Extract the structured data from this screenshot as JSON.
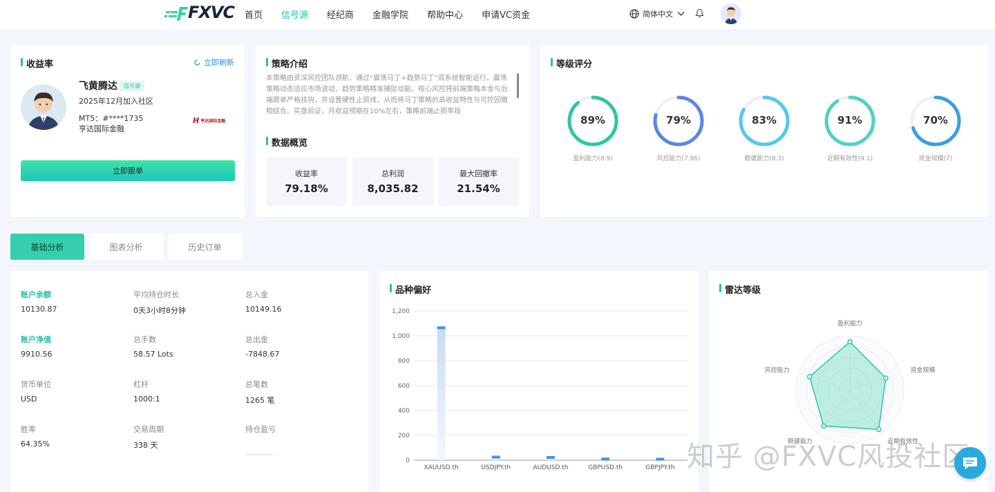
{
  "header": {
    "logo": "FXVC",
    "nav": [
      "首页",
      "信号源",
      "经纪商",
      "金融学院",
      "帮助中心",
      "申请VC资金"
    ],
    "active_nav": 1,
    "language": "简体中文"
  },
  "profile": {
    "title": "收益率",
    "refresh": "立即刷新",
    "name": "飞黄腾达",
    "badge": "信号源",
    "joined": "2025年12月加入社区",
    "mt5": "MT5：#****1735",
    "broker": "亨达国际金融",
    "broker_logo": "亨达国际金融",
    "follow_button": "立即跟单"
  },
  "strategy": {
    "title": "策略介绍",
    "text": "本策略由资深风控团队领航，通过“震荡马丁+趋势马丁”双系统智能运行。震荡策略动态适应市场波动，趋势策略精准捕捉动能。核心风控将前端策略本金与后端跟单严格挂钩，并设置硬性止损线，从而将马丁策略的高收益特性与可控回撤相结合。实盘验证，月收益预期在10%左右，策略前端止损率极",
    "overview_title": "数据概览",
    "stats": [
      {
        "label": "收益率",
        "value": "79.18%"
      },
      {
        "label": "总利润",
        "value": "8,035.82"
      },
      {
        "label": "最大回撤率",
        "value": "21.54%"
      }
    ]
  },
  "grade": {
    "title": "等级评分",
    "rings": [
      {
        "value": "89%",
        "label": "盈利能力(8.9)",
        "pct": 89,
        "color": "#2fc6a0"
      },
      {
        "value": "79%",
        "label": "风控能力(7.86)",
        "pct": 79,
        "color": "#5b86e5"
      },
      {
        "value": "83%",
        "label": "稳健能力(8.3)",
        "pct": 83,
        "color": "#52c9ec"
      },
      {
        "value": "91%",
        "label": "近期有效性(9.1)",
        "pct": 91,
        "color": "#4fd1c5"
      },
      {
        "value": "70%",
        "label": "资金规模(7)",
        "pct": 70,
        "color": "#3a9ee4"
      }
    ]
  },
  "tabs": [
    "基础分析",
    "图表分析",
    "历史订单"
  ],
  "account": {
    "items": [
      {
        "label": "账户余额",
        "value": "10130.87",
        "hl": true
      },
      {
        "label": "平均持仓时长",
        "value": "0天3小时8分钟"
      },
      {
        "label": "总入金",
        "value": "10149.16"
      },
      {
        "label": "账户净值",
        "value": "9910.56",
        "hl": true
      },
      {
        "label": "总手数",
        "value": "58.57 Lots"
      },
      {
        "label": "总出金",
        "value": "-7848.67"
      },
      {
        "label": "货币单位",
        "value": "USD"
      },
      {
        "label": "杠杆",
        "value": "1000:1"
      },
      {
        "label": "总笔数",
        "value": "1265 笔"
      },
      {
        "label": "胜率",
        "value": "64.35%"
      },
      {
        "label": "交易周期",
        "value": "338 天"
      },
      {
        "label": "持仓盈亏",
        "value": ""
      }
    ]
  },
  "chart_data": [
    {
      "type": "bar",
      "title": "品种偏好",
      "categories": [
        "XAUUSD.th",
        "USDJPY.th",
        "AUDUSD.th",
        "GBPUSD.th",
        "GBPJPY.th"
      ],
      "values": [
        1065,
        25,
        22,
        10,
        8
      ],
      "yticks": [
        0,
        200,
        400,
        600,
        800,
        "1,000",
        "1,200"
      ],
      "ylim": [
        0,
        1200
      ],
      "grid": true
    },
    {
      "type": "radar",
      "title": "雷达等级",
      "indicators": [
        "盈利能力",
        "资金规模",
        "近期有效性",
        "稳健能力",
        "风控能力"
      ],
      "values": [
        8.9,
        7,
        9.1,
        8.3,
        7.86
      ],
      "max": 10
    }
  ],
  "watermark": "知乎 @FXVC风投社区"
}
